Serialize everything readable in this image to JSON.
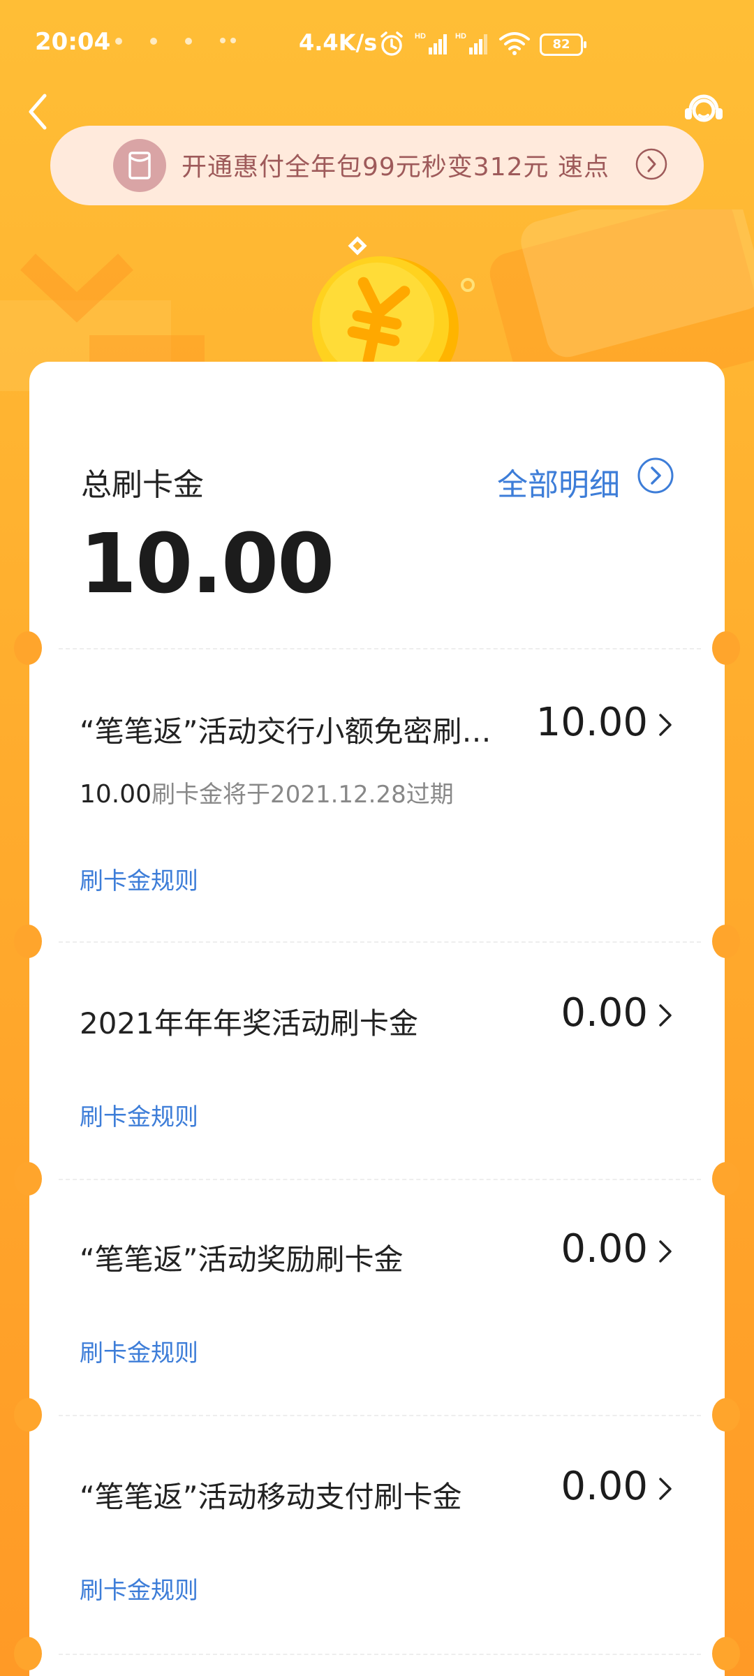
{
  "status_bar": {
    "time": "20:04",
    "net_speed": "4.4K/s",
    "battery": "82",
    "icons": [
      "alarm-icon",
      "signal-icon",
      "signal-icon",
      "wifi-icon",
      "battery-icon"
    ]
  },
  "header": {
    "back_icon": "chevron-left-icon",
    "service_icon": "customer-service-icon"
  },
  "promo": {
    "text": "开通惠付全年包99元秒变312元  速点",
    "icon": "red-envelope-icon",
    "arrow_icon": "chevron-right-circle-icon"
  },
  "summary": {
    "label": "总刷卡金",
    "amount": "10.00",
    "detail_link": "全部明细"
  },
  "items": [
    {
      "title": "“笔笔返”活动交行小额免密刷…",
      "amount": "10.00",
      "note_amount": "10.00",
      "note_text": "刷卡金将于2021.12.28过期",
      "rule": "刷卡金规则"
    },
    {
      "title": "2021年年年奖活动刷卡金",
      "amount": "0.00",
      "rule": "刷卡金规则"
    },
    {
      "title": "“笔笔返”活动奖励刷卡金",
      "amount": "0.00",
      "rule": "刷卡金规则"
    },
    {
      "title": "“笔笔返”活动移动支付刷卡金",
      "amount": "0.00",
      "rule": "刷卡金规则"
    }
  ],
  "colors": {
    "background": "#FFB030",
    "accent_blue": "#3D7DD8",
    "promo_text": "#9E5A5A",
    "coin": "#FFD21F"
  }
}
